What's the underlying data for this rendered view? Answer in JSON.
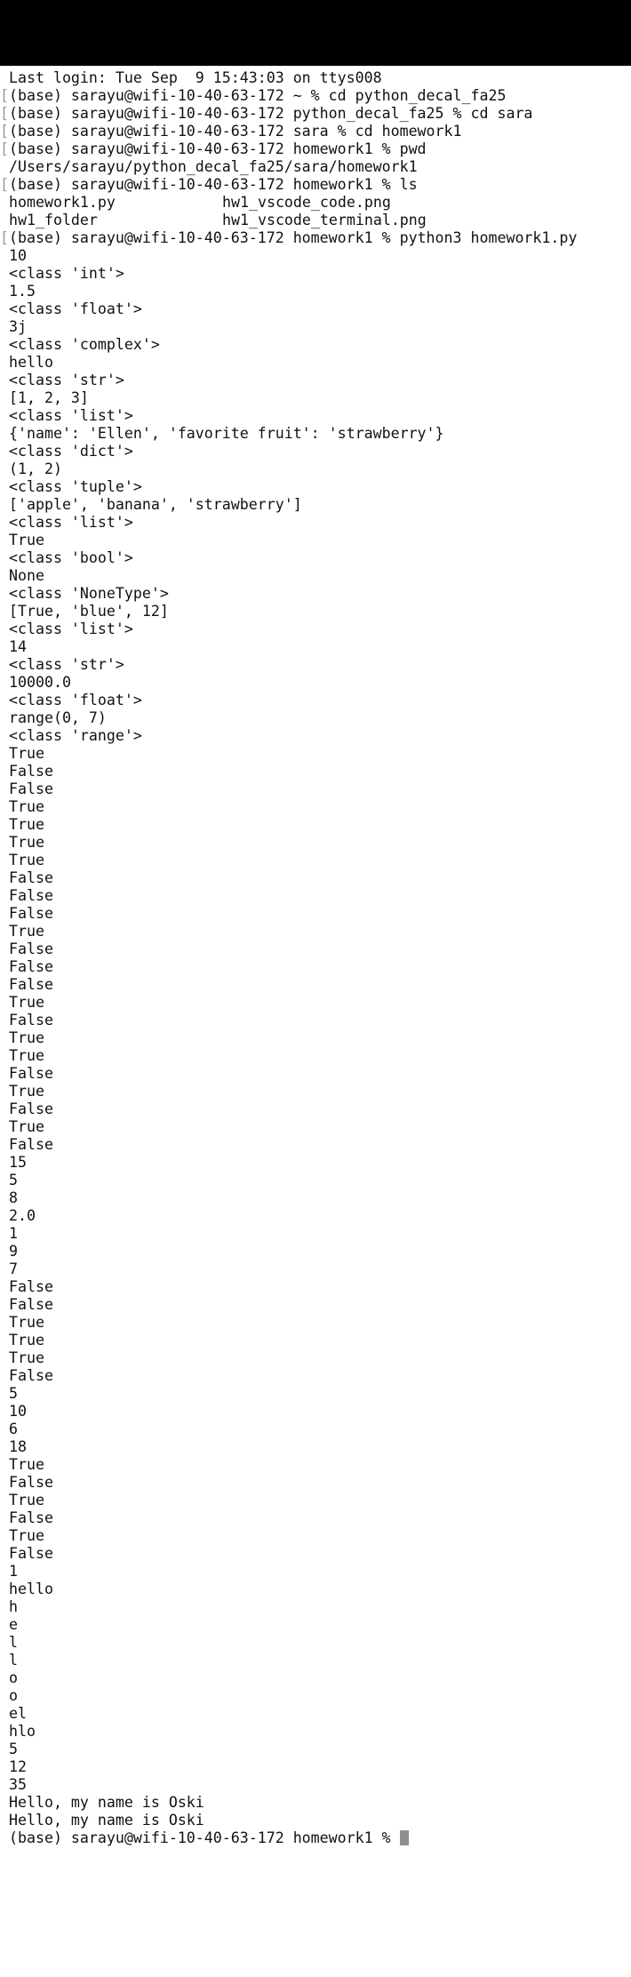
{
  "terminal": {
    "prompt_line": "(base) sarayu@wifi-10-40-63-172 homework1 % ",
    "lines": [
      {
        "text": "Last login: Tue Sep  9 15:43:03 on ttys008"
      },
      {
        "mark": "[",
        "text": "(base) sarayu@wifi-10-40-63-172 ~ % cd python_decal_fa25"
      },
      {
        "mark": "[",
        "text": "(base) sarayu@wifi-10-40-63-172 python_decal_fa25 % cd sara"
      },
      {
        "mark": "[",
        "text": "(base) sarayu@wifi-10-40-63-172 sara % cd homework1"
      },
      {
        "mark": "[",
        "text": "(base) sarayu@wifi-10-40-63-172 homework1 % pwd"
      },
      {
        "text": "/Users/sarayu/python_decal_fa25/sara/homework1"
      },
      {
        "mark": "[",
        "text": "(base) sarayu@wifi-10-40-63-172 homework1 % ls"
      },
      {
        "text": "homework1.py",
        "text2": "hw1_vscode_code.png"
      },
      {
        "text": "hw1_folder",
        "text2": "hw1_vscode_terminal.png"
      },
      {
        "mark": "[",
        "text": "(base) sarayu@wifi-10-40-63-172 homework1 % python3 homework1.py"
      },
      {
        "text": "10"
      },
      {
        "text": "<class 'int'>"
      },
      {
        "text": "1.5"
      },
      {
        "text": "<class 'float'>"
      },
      {
        "text": "3j"
      },
      {
        "text": "<class 'complex'>"
      },
      {
        "text": "hello"
      },
      {
        "text": "<class 'str'>"
      },
      {
        "text": "[1, 2, 3]"
      },
      {
        "text": "<class 'list'>"
      },
      {
        "text": "{'name': 'Ellen', 'favorite fruit': 'strawberry'}"
      },
      {
        "text": "<class 'dict'>"
      },
      {
        "text": "(1, 2)"
      },
      {
        "text": "<class 'tuple'>"
      },
      {
        "text": "['apple', 'banana', 'strawberry']"
      },
      {
        "text": "<class 'list'>"
      },
      {
        "text": "True"
      },
      {
        "text": "<class 'bool'>"
      },
      {
        "text": "None"
      },
      {
        "text": "<class 'NoneType'>"
      },
      {
        "text": "[True, 'blue', 12]"
      },
      {
        "text": "<class 'list'>"
      },
      {
        "text": "14"
      },
      {
        "text": "<class 'str'>"
      },
      {
        "text": "10000.0"
      },
      {
        "text": "<class 'float'>"
      },
      {
        "text": "range(0, 7)"
      },
      {
        "text": "<class 'range'>"
      },
      {
        "text": "True"
      },
      {
        "text": "False"
      },
      {
        "text": "False"
      },
      {
        "text": "True"
      },
      {
        "text": "True"
      },
      {
        "text": "True"
      },
      {
        "text": "True"
      },
      {
        "text": "False"
      },
      {
        "text": "False"
      },
      {
        "text": "False"
      },
      {
        "text": "True"
      },
      {
        "text": "False"
      },
      {
        "text": "False"
      },
      {
        "text": "False"
      },
      {
        "text": "True"
      },
      {
        "text": "False"
      },
      {
        "text": "True"
      },
      {
        "text": "True"
      },
      {
        "text": "False"
      },
      {
        "text": "True"
      },
      {
        "text": "False"
      },
      {
        "text": "True"
      },
      {
        "text": "False"
      },
      {
        "text": "15"
      },
      {
        "text": "5"
      },
      {
        "text": "8"
      },
      {
        "text": "2.0"
      },
      {
        "text": "1"
      },
      {
        "text": "9"
      },
      {
        "text": "7"
      },
      {
        "text": "False"
      },
      {
        "text": "False"
      },
      {
        "text": "True"
      },
      {
        "text": "True"
      },
      {
        "text": "True"
      },
      {
        "text": "False"
      },
      {
        "text": "5"
      },
      {
        "text": "10"
      },
      {
        "text": "6"
      },
      {
        "text": "18"
      },
      {
        "text": "True"
      },
      {
        "text": "False"
      },
      {
        "text": "True"
      },
      {
        "text": "False"
      },
      {
        "text": "True"
      },
      {
        "text": "False"
      },
      {
        "text": "1"
      },
      {
        "text": "hello"
      },
      {
        "text": "h"
      },
      {
        "text": "e"
      },
      {
        "text": "l"
      },
      {
        "text": "l"
      },
      {
        "text": "o"
      },
      {
        "text": "o"
      },
      {
        "text": "el"
      },
      {
        "text": "hlo"
      },
      {
        "text": "5"
      },
      {
        "text": "12"
      },
      {
        "text": "35"
      },
      {
        "text": "Hello, my name is Oski"
      },
      {
        "text": "Hello, my name is Oski"
      }
    ]
  }
}
